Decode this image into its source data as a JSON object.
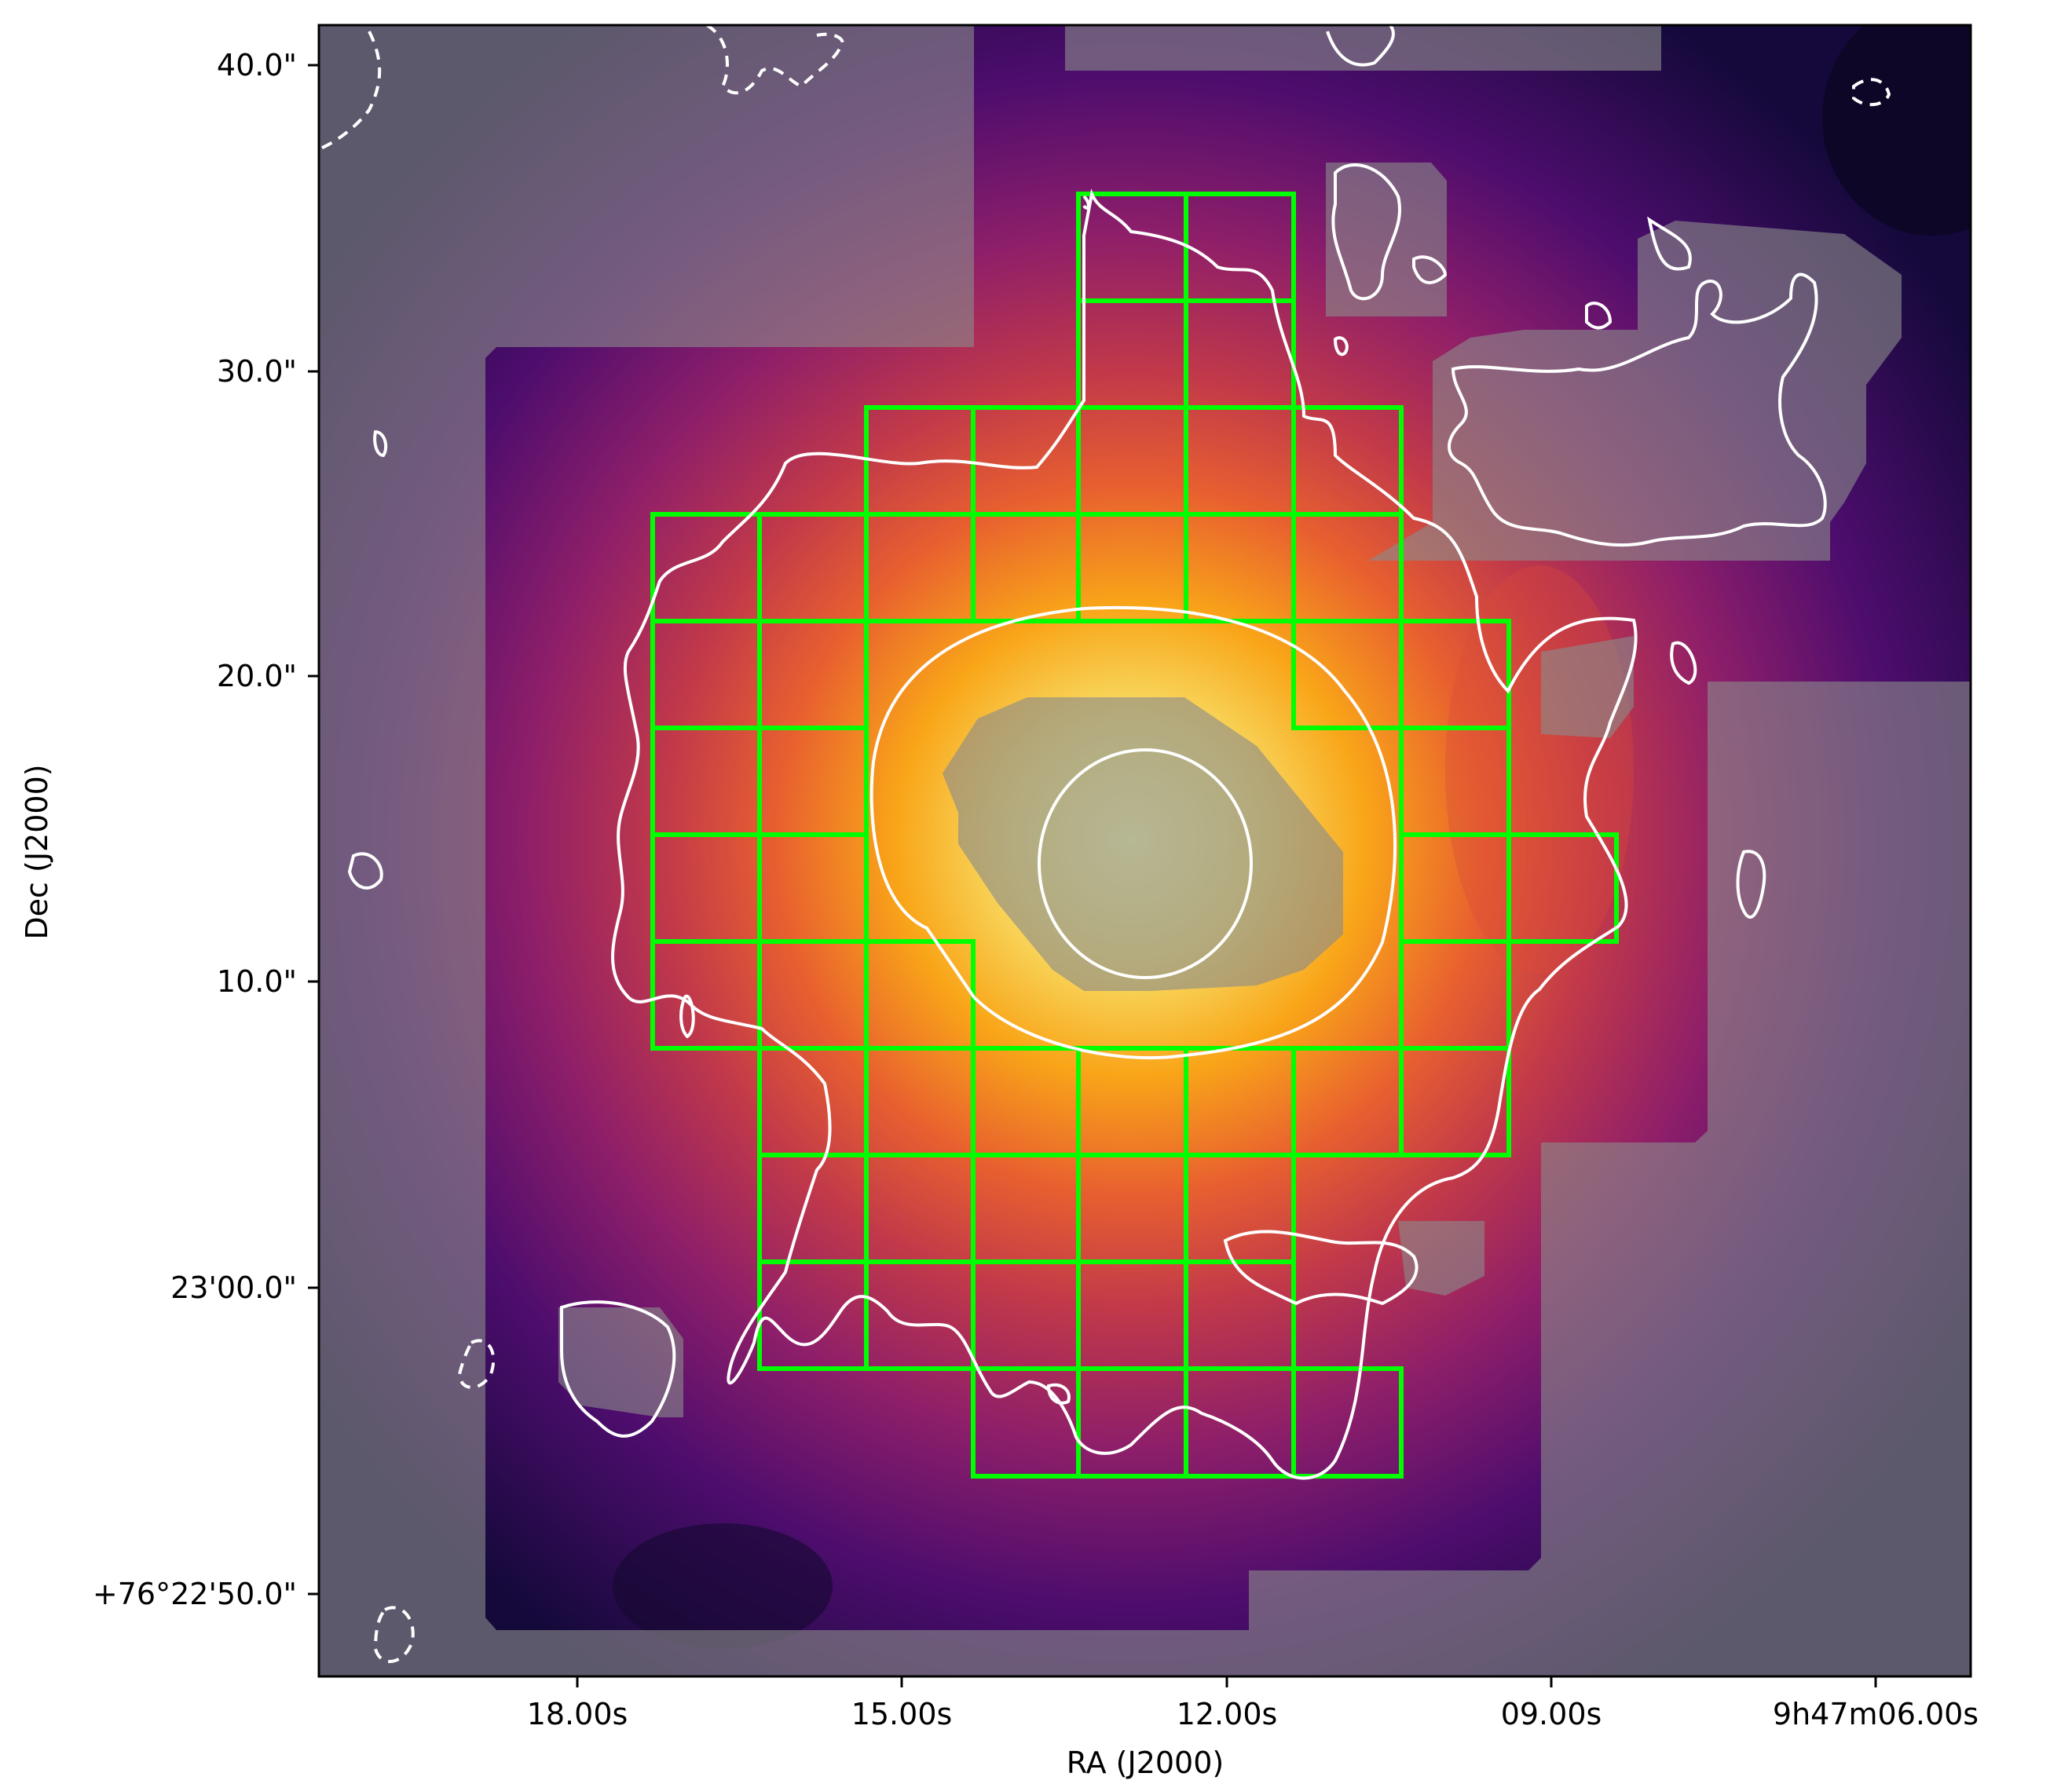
{
  "plot": {
    "xlabel": "RA (J2000)",
    "ylabel": "Dec (J2000)",
    "xticks": [
      "18.00s",
      "15.00s",
      "12.00s",
      "09.00s",
      "9h47m06.00s"
    ],
    "yticks": [
      "40.0\"",
      "30.0\"",
      "20.0\"",
      "10.0\"",
      "23'00.0\"",
      "+76°22'50.0\""
    ],
    "colormap": "inferno",
    "colors": {
      "grid_boxes": "#00ff00",
      "contours": "#ffffff",
      "masked_regions": "#8a8a8a",
      "frame": "#000000"
    }
  }
}
